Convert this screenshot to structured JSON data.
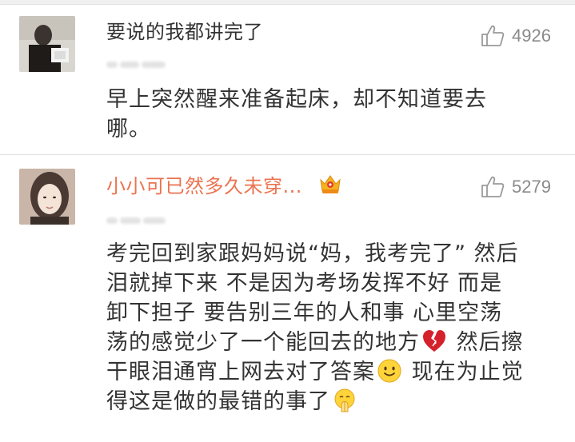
{
  "comments": [
    {
      "username": "要说的我都讲完了",
      "likes": "4926",
      "text_lines": [
        "早上突然醒来准备起床，却不知道要去",
        "哪。"
      ]
    },
    {
      "username": "小小可已然多久未穿...",
      "likes": "5279",
      "line1": "考完回到家跟妈妈说“妈，我考完了” 然后",
      "line2": "泪就掉下来 不是因为考场发挥不好 而是",
      "line3": "卸下担子 要告别三年的人和事 心里空荡",
      "line4a": "荡的感觉少了一个能回去的地方",
      "line4b": " 然后擦",
      "line5a": "干眼泪通宵上网去对了答案",
      "line5b": " 现在为止觉",
      "line6a": "得这是做的最错的事了"
    }
  ],
  "icons": {
    "like": "thumbs-up-icon",
    "broken_heart": "broken-heart-emoji",
    "smile": "smile-emoji",
    "pray": "pray-emoji",
    "vip": "vip-crown-badge"
  },
  "colors": {
    "username_highlight": "#eb7350",
    "text": "#333333",
    "muted": "#8a8a8a"
  }
}
